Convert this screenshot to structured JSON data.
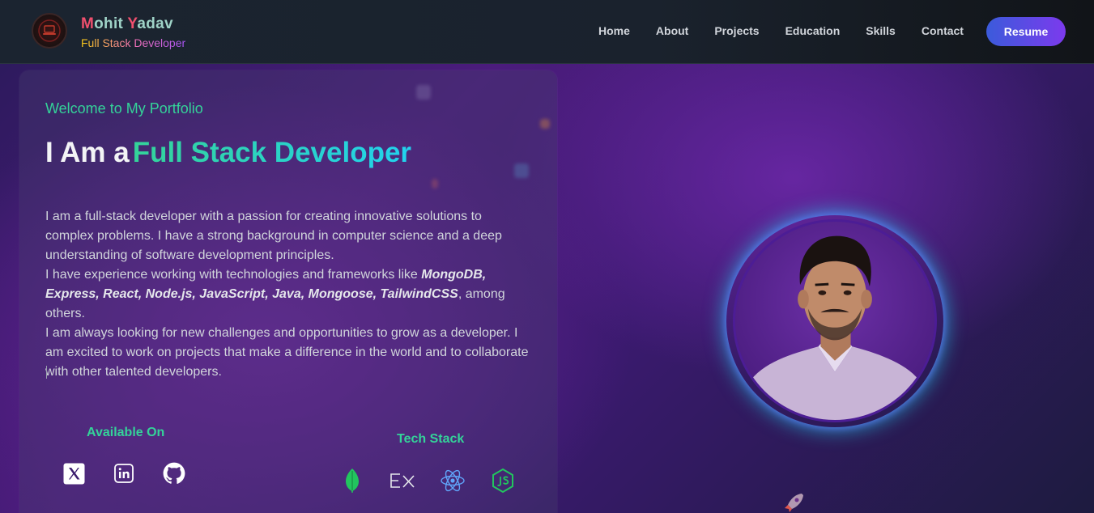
{
  "navbar": {
    "brand_first": "M",
    "brand_first_rest": "ohit ",
    "brand_last": "Y",
    "brand_last_rest": "adav",
    "brand_subtitle": "Full Stack Developer",
    "links": [
      "Home",
      "About",
      "Projects",
      "Education",
      "Skills",
      "Contact"
    ],
    "resume_label": "Resume",
    "logo_icon": "laptop-logo-icon"
  },
  "hero": {
    "welcome": "Welcome to My Portfolio",
    "headline_prefix": "I Am a",
    "headline_role": "Full Stack Developer",
    "bio_p1": "I am a full-stack developer with a passion for creating innovative solutions to complex problems. I have a strong background in computer science and a deep understanding of software development principles.",
    "bio_p2_prefix": "I have experience working with technologies and frameworks like ",
    "bio_p2_techs": "MongoDB, Express, React, Node.js, JavaScript, Java, Mongoose, TailwindCSS",
    "bio_p2_suffix": ", among others.",
    "bio_p3": "I am always looking for new challenges and opportunities to grow as a developer. I am excited to work on projects that make a difference in the world and to collaborate with other talented developers.",
    "available_on": "Available On",
    "socials": [
      "x-icon",
      "linkedin-icon",
      "github-icon"
    ],
    "tech_stack_title": "Tech Stack",
    "tech_stack": [
      "mongodb-icon",
      "express-icon",
      "react-icon",
      "nodejs-icon"
    ]
  },
  "colors": {
    "accent_green": "#34d399",
    "accent_cyan": "#22d3ee",
    "resume_gradient_start": "#3b5bdb",
    "resume_gradient_end": "#7c3aed"
  }
}
